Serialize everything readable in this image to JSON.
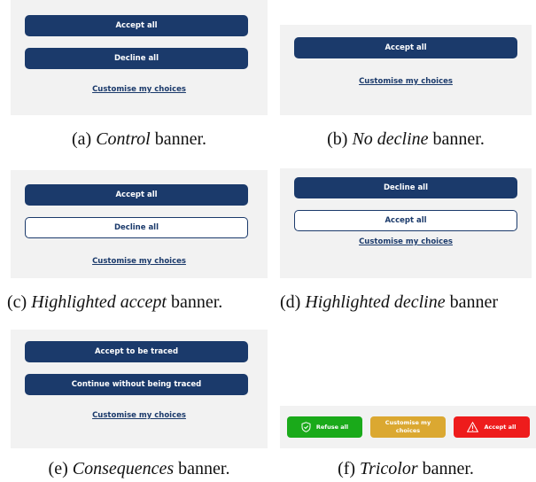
{
  "panels": {
    "a": {
      "accept": "Accept all",
      "decline": "Decline all",
      "customise": "Customise my choices",
      "caption_prefix": "(a) ",
      "caption_em": "Control",
      "caption_suffix": " banner."
    },
    "b": {
      "accept": "Accept all",
      "customise": "Customise my choices",
      "caption_prefix": "(b) ",
      "caption_em": "No decline",
      "caption_suffix": " banner."
    },
    "c": {
      "accept": "Accept all",
      "decline": "Decline all",
      "customise": "Customise my choices",
      "caption_prefix": "(c) ",
      "caption_em": "Highlighted accept",
      "caption_suffix": " banner."
    },
    "d": {
      "decline": "Decline all",
      "accept": "Accept all",
      "customise": "Customise my choices",
      "caption_prefix": "(d) ",
      "caption_em": "Highlighted decline",
      "caption_suffix": " banner"
    },
    "e": {
      "accept": "Accept to be traced",
      "decline": "Continue without being traced",
      "customise": "Customise my choices",
      "caption_prefix": "(e) ",
      "caption_em": "Consequences",
      "caption_suffix": " banner."
    },
    "f": {
      "refuse": "Refuse all",
      "customise": "Customise my choices",
      "accept": "Accept all",
      "caption_prefix": "(f) ",
      "caption_em": "Tricolor",
      "caption_suffix": " banner."
    }
  },
  "colors": {
    "navy": "#1b3a6b",
    "panel_bg": "#f2f2f2",
    "refuse_green": "#1aaa1a",
    "customise_amber": "#dba831",
    "accept_red": "#ee1c1c"
  },
  "icons": {
    "refuse": "shield-check-icon",
    "accept": "warning-triangle-icon"
  }
}
